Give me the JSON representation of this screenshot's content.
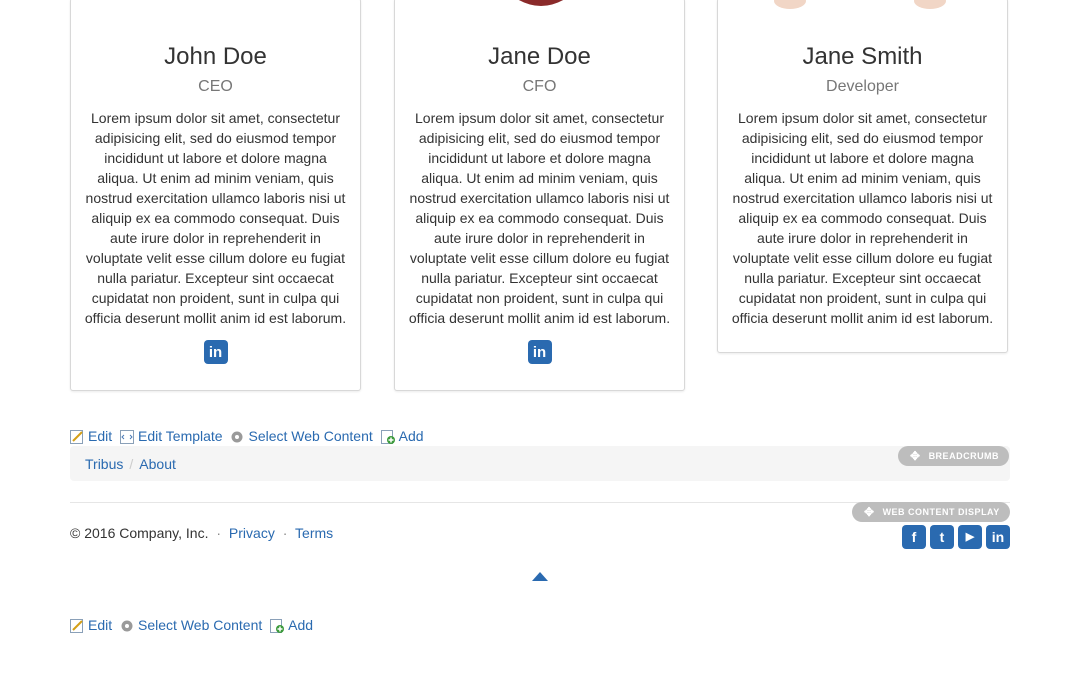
{
  "cards": [
    {
      "name": "John Doe",
      "role": "CEO",
      "bio": "Lorem ipsum dolor sit amet, consectetur adipisicing elit, sed do eiusmod tempor incididunt ut labore et dolore magna aliqua. Ut enim ad minim veniam, quis nostrud exercitation ullamco laboris nisi ut aliquip ex ea commodo consequat. Duis aute irure dolor in reprehenderit in voluptate velit esse cillum dolore eu fugiat nulla pariatur. Excepteur sint occaecat cupidatat non proident, sunt in culpa qui officia deserunt mollit anim id est laborum.",
      "icon": "linkedin-icon",
      "icon_glyph": "in"
    },
    {
      "name": "Jane Doe",
      "role": "CFO",
      "bio": "Lorem ipsum dolor sit amet, consectetur adipisicing elit, sed do eiusmod tempor incididunt ut labore et dolore magna aliqua. Ut enim ad minim veniam, quis nostrud exercitation ullamco laboris nisi ut aliquip ex ea commodo consequat. Duis aute irure dolor in reprehenderit in voluptate velit esse cillum dolore eu fugiat nulla pariatur. Excepteur sint occaecat cupidatat non proident, sunt in culpa qui officia deserunt mollit anim id est laborum.",
      "icon": "linkedin-icon",
      "icon_glyph": "in"
    },
    {
      "name": "Jane Smith",
      "role": "Developer",
      "bio": "Lorem ipsum dolor sit amet, consectetur adipisicing elit, sed do eiusmod tempor incididunt ut labore et dolore magna aliqua. Ut enim ad minim veniam, quis nostrud exercitation ullamco laboris nisi ut aliquip ex ea commodo consequat. Duis aute irure dolor in reprehenderit in voluptate velit esse cillum dolore eu fugiat nulla pariatur. Excepteur sint occaecat cupidatat non proident, sunt in culpa qui officia deserunt mollit anim id est laborum."
    }
  ],
  "toolbar1": {
    "edit": "Edit",
    "edit_template": "Edit Template",
    "select_web_content": "Select Web Content",
    "add": "Add"
  },
  "breadcrumb": {
    "items": [
      "Tribus",
      "About"
    ],
    "separator": "/",
    "badge": "BREADCRUMB"
  },
  "web_content_badge": "WEB CONTENT DISPLAY",
  "footer": {
    "copyright": "© 2016 Company, Inc.",
    "separator": "·",
    "privacy": "Privacy",
    "terms": "Terms"
  },
  "social": [
    {
      "icon": "facebook-icon",
      "glyph": "f"
    },
    {
      "icon": "twitter-icon",
      "glyph": "t"
    },
    {
      "icon": "youtube-icon",
      "glyph": "▶"
    },
    {
      "icon": "linkedin-icon",
      "glyph": "in"
    }
  ],
  "back_to_top_icon": "caret-up-icon",
  "toolbar2": {
    "edit": "Edit",
    "select_web_content": "Select Web Content",
    "add": "Add"
  },
  "colors": {
    "link": "#2a6ab0",
    "badge": "#bdbdbd"
  }
}
